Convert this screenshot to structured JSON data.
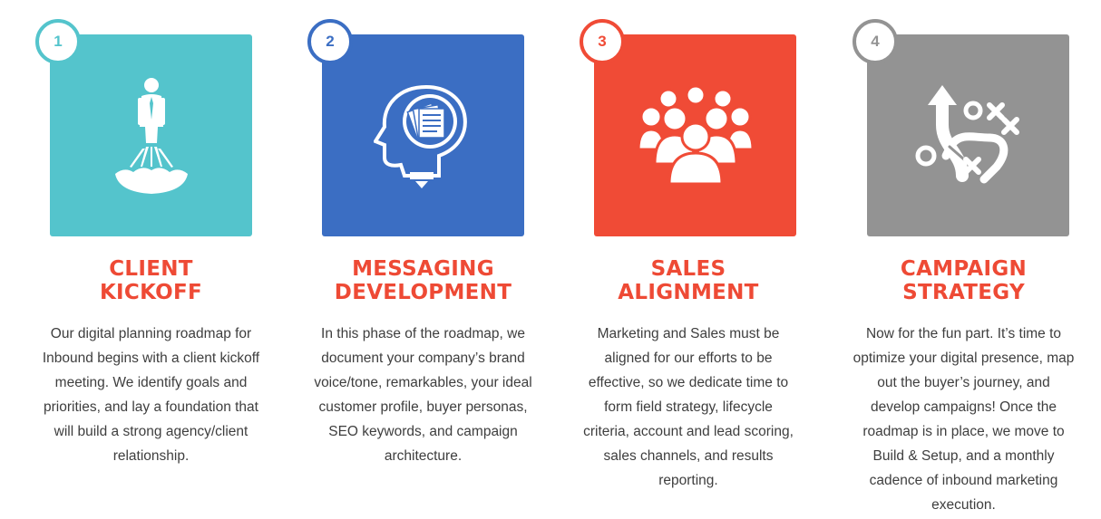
{
  "colors": {
    "teal": "#54c4cc",
    "blue": "#3b6ec3",
    "red": "#f04b36",
    "gray": "#939393",
    "heading": "#ee4a35",
    "body_text": "#3e3e3e"
  },
  "steps": [
    {
      "number": "1",
      "title_line1": "CLIENT",
      "title_line2": "KICKOFF",
      "icon": "rocket-person-icon",
      "description": "Our digital planning roadmap for Inbound begins with a client kickoff meeting. We identify goals and priorities, and lay a foundation that will build a strong agency/client relationship."
    },
    {
      "number": "2",
      "title_line1": "MESSAGING",
      "title_line2": "DEVELOPMENT",
      "icon": "head-documents-icon",
      "description": "In this phase of the roadmap, we document your company’s brand voice/tone, remarkables, your ideal customer profile, buyer personas, SEO keywords, and campaign architecture."
    },
    {
      "number": "3",
      "title_line1": "SALES",
      "title_line2": "ALIGNMENT",
      "icon": "group-people-icon",
      "description": "Marketing and Sales must be aligned for our efforts to be effective, so we dedicate time to form field strategy, lifecycle criteria, account and lead scoring, sales channels, and results reporting."
    },
    {
      "number": "4",
      "title_line1": "CAMPAIGN",
      "title_line2": "STRATEGY",
      "icon": "strategy-play-icon",
      "description": "Now for the fun part. It’s time to optimize your digital presence, map out the buyer’s journey, and develop campaigns! Once the roadmap is in place, we move to Build & Setup, and a monthly cadence of inbound marketing execution."
    }
  ]
}
